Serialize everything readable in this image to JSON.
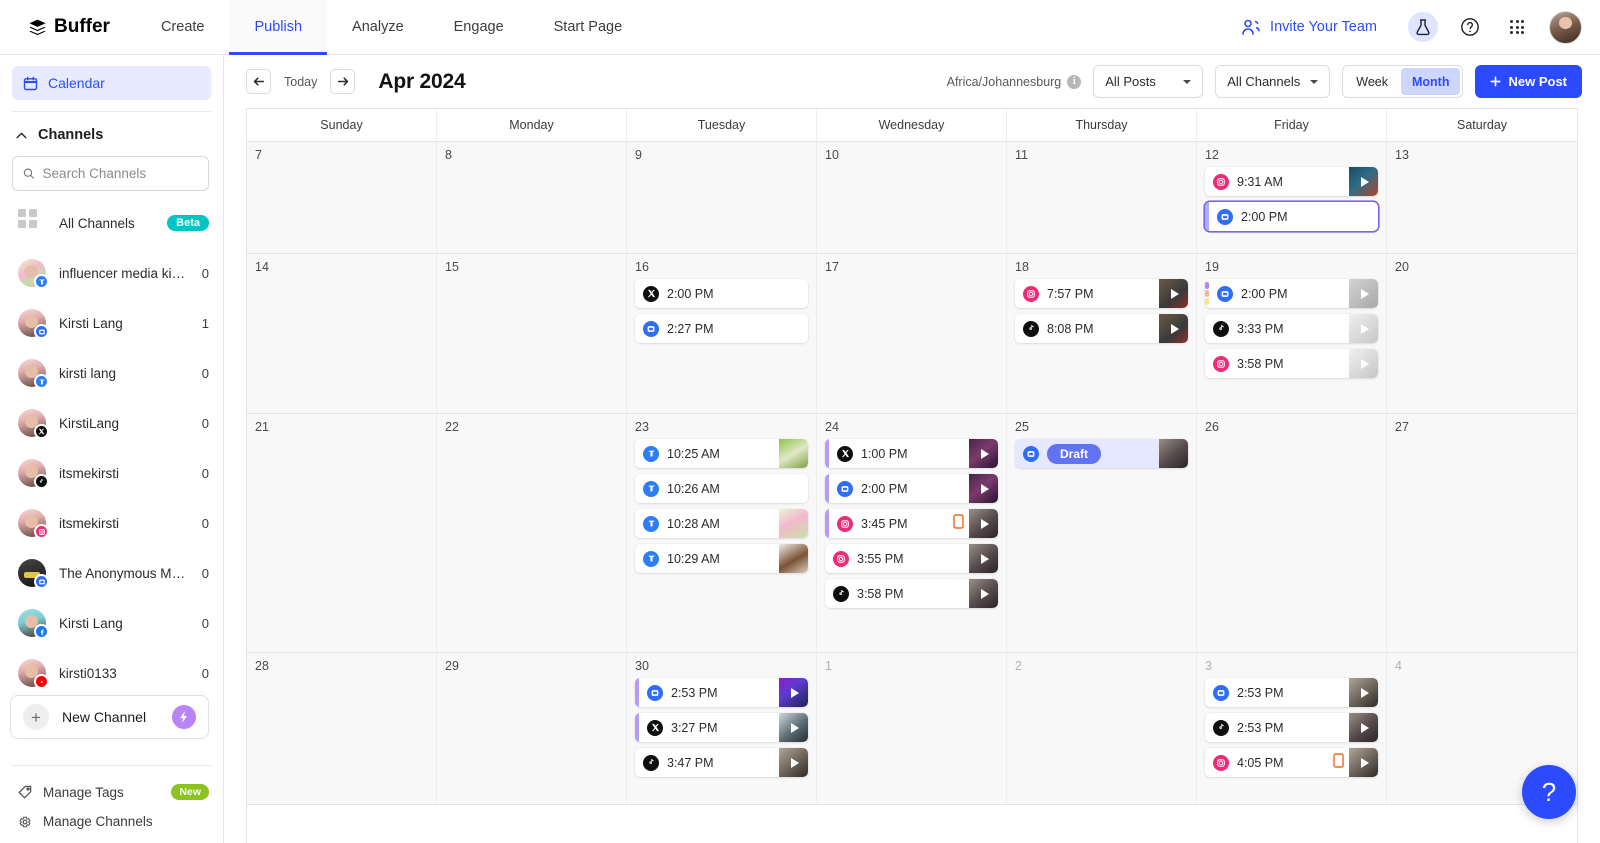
{
  "topnav": {
    "brand": "Buffer",
    "brand_icon": "buffer-logo-icon",
    "tabs": [
      {
        "label": "Create",
        "active": false
      },
      {
        "label": "Publish",
        "active": true
      },
      {
        "label": "Analyze",
        "active": false
      },
      {
        "label": "Engage",
        "active": false
      },
      {
        "label": "Start Page",
        "active": false
      }
    ],
    "invite_label": "Invite Your Team",
    "invite_icon": "people-add-icon",
    "lab_icon": "flask-icon",
    "help_icon": "question-circle-icon",
    "apps_icon": "grid-apps-icon",
    "avatar_icon": "user-avatar"
  },
  "sidebar": {
    "calendar_label": "Calendar",
    "calendar_icon": "calendar-icon",
    "channels_label": "Channels",
    "collapse_icon": "chevron-up-icon",
    "search": {
      "placeholder": "Search Channels",
      "value": "",
      "icon": "search-icon"
    },
    "all_channels": {
      "label": "All Channels",
      "badge": "Beta",
      "icon": "grid-squares-icon"
    },
    "channels": [
      {
        "name": "influencer media kit te...",
        "count": "0",
        "network": "bluesky",
        "avatar": "flower"
      },
      {
        "name": "Kirsti Lang",
        "count": "1",
        "network": "mastodon",
        "avatar": "person"
      },
      {
        "name": "kirsti lang",
        "count": "0",
        "network": "bluesky",
        "avatar": "person"
      },
      {
        "name": "KirstiLang",
        "count": "0",
        "network": "x",
        "avatar": "person"
      },
      {
        "name": "itsmekirsti",
        "count": "0",
        "network": "tiktok",
        "avatar": "person"
      },
      {
        "name": "itsmekirsti",
        "count": "0",
        "network": "instagram",
        "avatar": "person"
      },
      {
        "name": "The Anonymous Marke...",
        "count": "0",
        "network": "mastodon",
        "avatar": "dark"
      },
      {
        "name": "Kirsti Lang",
        "count": "0",
        "network": "facebook",
        "avatar": "teal"
      },
      {
        "name": "kirsti0133",
        "count": "0",
        "network": "youtube",
        "avatar": "person"
      }
    ],
    "new_channel": {
      "label": "New Channel",
      "plus_icon": "plus-icon",
      "bolt_icon": "bolt-icon"
    },
    "footer": [
      {
        "label": "Manage Tags",
        "icon": "tag-icon",
        "badge": "New"
      },
      {
        "label": "Manage Channels",
        "icon": "gear-icon",
        "badge": ""
      }
    ]
  },
  "toolbar": {
    "prev_icon": "arrow-left-icon",
    "next_icon": "arrow-right-icon",
    "today_label": "Today",
    "month_title": "Apr 2024",
    "timezone": "Africa/Johannesburg",
    "info_icon": "info-icon",
    "posts_filter": "All Posts",
    "channels_filter": "All Channels",
    "view_week": "Week",
    "view_month": "Month",
    "view_active": "Month",
    "new_post_label": "New Post",
    "new_post_icon": "plus-icon",
    "accent_color": "#2c4bff"
  },
  "calendar": {
    "day_names": [
      "Sunday",
      "Monday",
      "Tuesday",
      "Wednesday",
      "Thursday",
      "Friday",
      "Saturday"
    ],
    "weeks": [
      {
        "days": [
          {
            "num": "7",
            "other": false,
            "posts": []
          },
          {
            "num": "8",
            "other": false,
            "posts": []
          },
          {
            "num": "9",
            "other": false,
            "posts": []
          },
          {
            "num": "10",
            "other": false,
            "posts": []
          },
          {
            "num": "11",
            "other": false,
            "posts": []
          },
          {
            "num": "12",
            "other": false,
            "posts": [
              {
                "time": "9:31 AM",
                "network": "instagram",
                "thumb": "t-a",
                "video": true
              },
              {
                "time": "2:00 PM",
                "network": "mastodon",
                "thumb": "",
                "video": false,
                "selected": true,
                "lbar": "#a9b0f8"
              }
            ]
          },
          {
            "num": "13",
            "other": false,
            "posts": []
          }
        ]
      },
      {
        "days": [
          {
            "num": "14",
            "other": false,
            "posts": []
          },
          {
            "num": "15",
            "other": false,
            "posts": []
          },
          {
            "num": "16",
            "other": false,
            "posts": [
              {
                "time": "2:00 PM",
                "network": "x",
                "thumb": "",
                "video": false
              },
              {
                "time": "2:27 PM",
                "network": "mastodon",
                "thumb": "",
                "video": false
              }
            ]
          },
          {
            "num": "17",
            "other": false,
            "posts": []
          },
          {
            "num": "18",
            "other": false,
            "posts": [
              {
                "time": "7:57 PM",
                "network": "instagram",
                "thumb": "t-b",
                "video": true
              },
              {
                "time": "8:08 PM",
                "network": "tiktok",
                "thumb": "t-b",
                "video": true
              }
            ]
          },
          {
            "num": "19",
            "other": false,
            "posts": [
              {
                "time": "2:00 PM",
                "network": "mastodon",
                "thumb": "t-c",
                "video": true,
                "tags": [
                  "#a98bf0",
                  "#f7b29a",
                  "#f6e68d"
                ]
              },
              {
                "time": "3:33 PM",
                "network": "tiktok",
                "thumb": "t-d",
                "video": true
              },
              {
                "time": "3:58 PM",
                "network": "instagram",
                "thumb": "t-d",
                "video": true
              }
            ]
          },
          {
            "num": "20",
            "other": false,
            "posts": []
          }
        ]
      },
      {
        "days": [
          {
            "num": "21",
            "other": false,
            "posts": []
          },
          {
            "num": "22",
            "other": false,
            "posts": []
          },
          {
            "num": "23",
            "other": false,
            "posts": [
              {
                "time": "10:25 AM",
                "network": "bluesky",
                "thumb": "t-e",
                "video": false
              },
              {
                "time": "10:26 AM",
                "network": "bluesky",
                "thumb": "",
                "video": false
              },
              {
                "time": "10:28 AM",
                "network": "bluesky",
                "thumb": "t-f",
                "video": false
              },
              {
                "time": "10:29 AM",
                "network": "bluesky",
                "thumb": "t-g",
                "video": false
              }
            ]
          },
          {
            "num": "24",
            "other": false,
            "posts": [
              {
                "time": "1:00 PM",
                "network": "x",
                "thumb": "t-h",
                "video": true,
                "lbar": "#b49df5"
              },
              {
                "time": "2:00 PM",
                "network": "mastodon",
                "thumb": "t-h",
                "video": true,
                "lbar": "#b49df5"
              },
              {
                "time": "3:45 PM",
                "network": "instagram",
                "thumb": "t-i",
                "video": true,
                "lbar": "#b49df5",
                "phone": true
              },
              {
                "time": "3:55 PM",
                "network": "instagram",
                "thumb": "t-i",
                "video": true
              },
              {
                "time": "3:58 PM",
                "network": "tiktok",
                "thumb": "t-i",
                "video": true
              }
            ]
          },
          {
            "num": "25",
            "other": false,
            "posts": [
              {
                "time": "",
                "draft": "Draft",
                "network": "mastodon",
                "thumb": "t-i",
                "video": false
              }
            ]
          },
          {
            "num": "26",
            "other": false,
            "posts": []
          },
          {
            "num": "27",
            "other": false,
            "posts": []
          }
        ]
      },
      {
        "days": [
          {
            "num": "28",
            "other": false,
            "posts": []
          },
          {
            "num": "29",
            "other": false,
            "posts": []
          },
          {
            "num": "30",
            "other": false,
            "posts": [
              {
                "time": "2:53 PM",
                "network": "mastodon",
                "thumb": "t-j",
                "video": true,
                "lbar": "#b49df5"
              },
              {
                "time": "3:27 PM",
                "network": "x",
                "thumb": "t-k",
                "video": true,
                "lbar": "#b49df5"
              },
              {
                "time": "3:47 PM",
                "network": "tiktok",
                "thumb": "t-l",
                "video": true
              }
            ]
          },
          {
            "num": "1",
            "other": true,
            "posts": []
          },
          {
            "num": "2",
            "other": true,
            "posts": []
          },
          {
            "num": "3",
            "other": true,
            "posts": [
              {
                "time": "2:53 PM",
                "network": "mastodon",
                "thumb": "t-l",
                "video": true
              },
              {
                "time": "2:53 PM",
                "network": "tiktok",
                "thumb": "t-i",
                "video": true
              },
              {
                "time": "4:05 PM",
                "network": "instagram",
                "thumb": "t-l",
                "video": true,
                "phone": true
              }
            ]
          },
          {
            "num": "4",
            "other": true,
            "posts": []
          }
        ]
      }
    ]
  },
  "help_fab": {
    "label": "?",
    "icon": "question-icon"
  }
}
